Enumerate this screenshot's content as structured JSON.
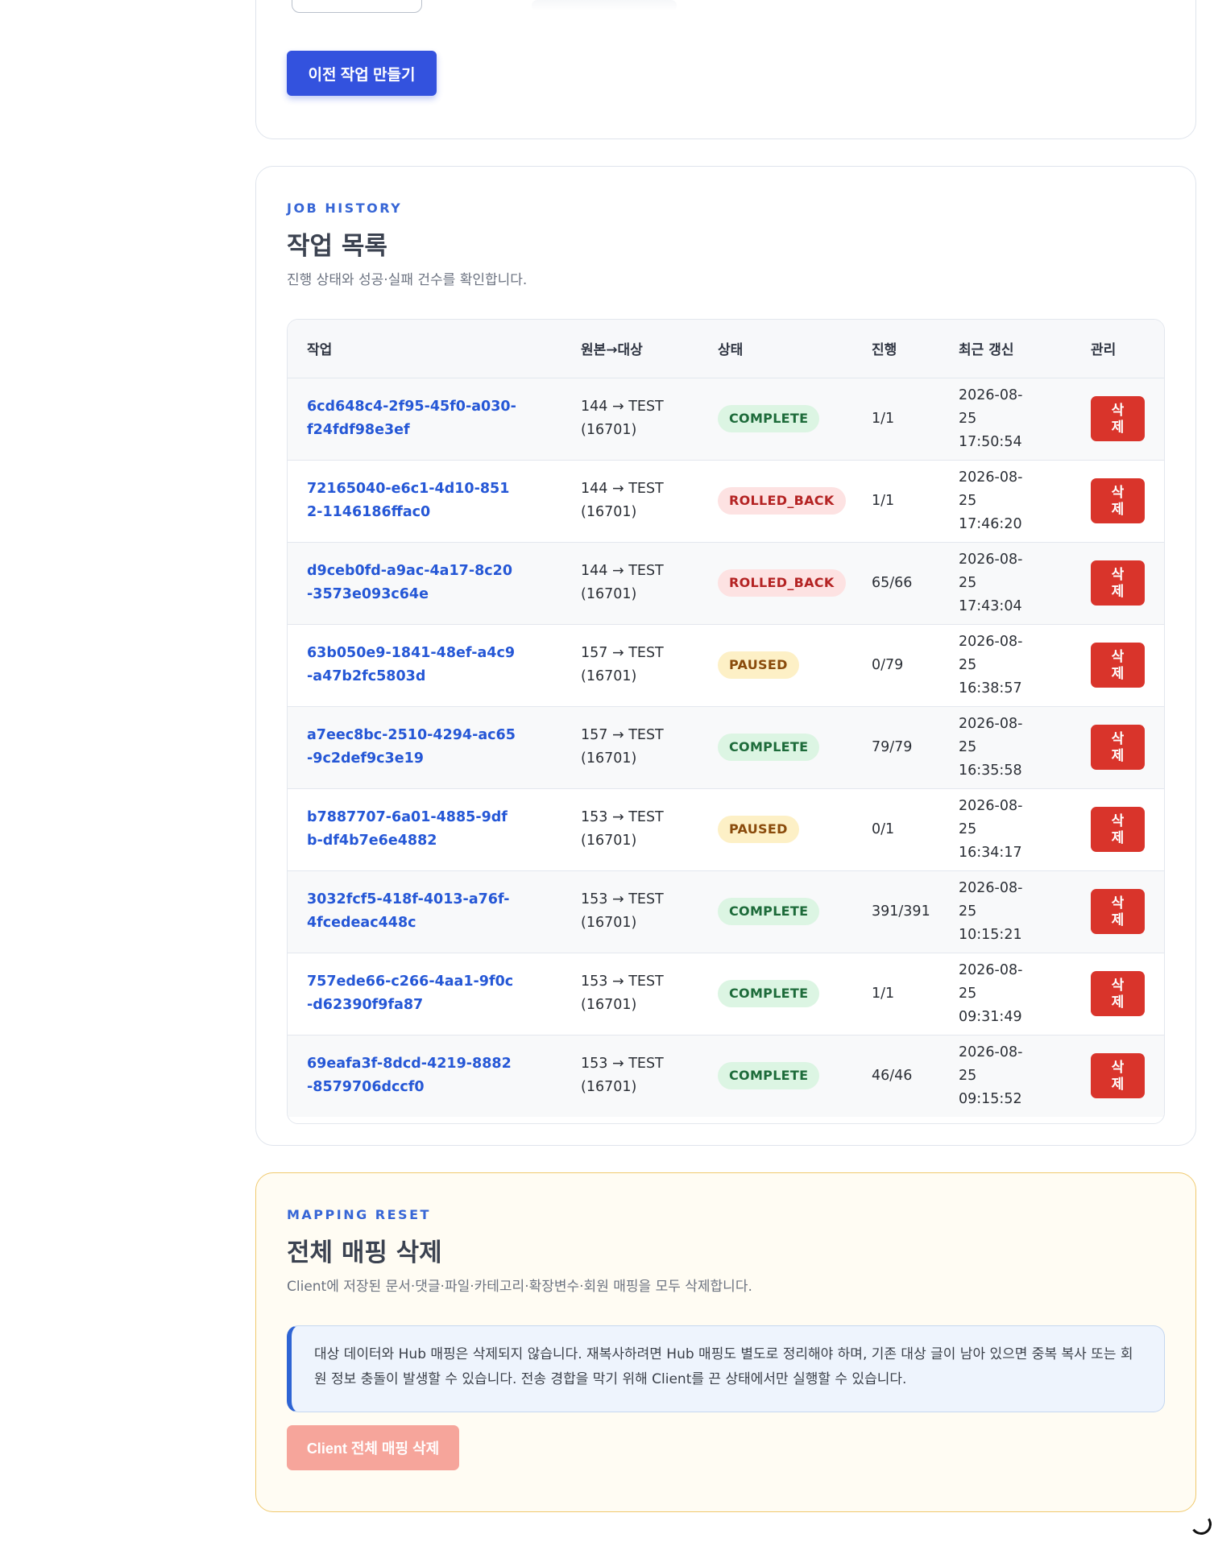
{
  "prev_card": {
    "create_button_label": "이전 작업 만들기"
  },
  "job_history": {
    "eyebrow": "JOB HISTORY",
    "title": "작업 목록",
    "description": "진행 상태와 성공·실패 건수를 확인합니다.",
    "columns": {
      "job": "작업",
      "route": "원본→대상",
      "status": "상태",
      "progress": "진행",
      "updated": "최근 갱신",
      "manage": "관리"
    },
    "rows": [
      {
        "job_id": "6cd648c4-2f95-45f0-a030-f24fdf98e3ef",
        "route": "144 → TEST (16701)",
        "status": "COMPLETE",
        "progress": "1/1",
        "updated": "2026-08-25 17:50:54",
        "delete_label": "삭제"
      },
      {
        "job_id": "72165040-e6c1-4d10-8512-1146186ffac0",
        "route": "144 → TEST (16701)",
        "status": "ROLLED_BACK",
        "progress": "1/1",
        "updated": "2026-08-25 17:46:20",
        "delete_label": "삭제"
      },
      {
        "job_id": "d9ceb0fd-a9ac-4a17-8c20-3573e093c64e",
        "route": "144 → TEST (16701)",
        "status": "ROLLED_BACK",
        "progress": "65/66",
        "updated": "2026-08-25 17:43:04",
        "delete_label": "삭제"
      },
      {
        "job_id": "63b050e9-1841-48ef-a4c9-a47b2fc5803d",
        "route": "157 → TEST (16701)",
        "status": "PAUSED",
        "progress": "0/79",
        "updated": "2026-08-25 16:38:57",
        "delete_label": "삭제"
      },
      {
        "job_id": "a7eec8bc-2510-4294-ac65-9c2def9c3e19",
        "route": "157 → TEST (16701)",
        "status": "COMPLETE",
        "progress": "79/79",
        "updated": "2026-08-25 16:35:58",
        "delete_label": "삭제"
      },
      {
        "job_id": "b7887707-6a01-4885-9dfb-df4b7e6e4882",
        "route": "153 → TEST (16701)",
        "status": "PAUSED",
        "progress": "0/1",
        "updated": "2026-08-25 16:34:17",
        "delete_label": "삭제"
      },
      {
        "job_id": "3032fcf5-418f-4013-a76f-4fcedeac448c",
        "route": "153 → TEST (16701)",
        "status": "COMPLETE",
        "progress": "391/391",
        "updated": "2026-08-25 10:15:21",
        "delete_label": "삭제"
      },
      {
        "job_id": "757ede66-c266-4aa1-9f0c-d62390f9fa87",
        "route": "153 → TEST (16701)",
        "status": "COMPLETE",
        "progress": "1/1",
        "updated": "2026-08-25 09:31:49",
        "delete_label": "삭제"
      },
      {
        "job_id": "69eafa3f-8dcd-4219-8882-8579706dccf0",
        "route": "153 → TEST (16701)",
        "status": "COMPLETE",
        "progress": "46/46",
        "updated": "2026-08-25 09:15:52",
        "delete_label": "삭제"
      }
    ]
  },
  "mapping_reset": {
    "eyebrow": "MAPPING RESET",
    "title": "전체 매핑 삭제",
    "description": "Client에 저장된 문서·댓글·파일·카테고리·확장변수·회원 매핑을 모두 삭제합니다.",
    "notice": "대상 데이터와 Hub 매핑은 삭제되지 않습니다. 재복사하려면 Hub 매핑도 별도로 정리해야 하며, 기존 대상 글이 남아 있으면 중복 복사 또는 회원 정보 충돌이 발생할 수 있습니다. 전송 경합을 막기 위해 Client를 끈 상태에서만 실행할 수 있습니다.",
    "reset_button_label": "Client 전체 매핑 삭제"
  },
  "colors": {
    "primary": "#3352de",
    "danger": "#d9342b",
    "danger_disabled": "#f6a59b",
    "link": "#2557d6",
    "complete_bg": "#dcf5e3",
    "rolled_back_bg": "#fde2e2",
    "paused_bg": "#fdf0c6"
  }
}
